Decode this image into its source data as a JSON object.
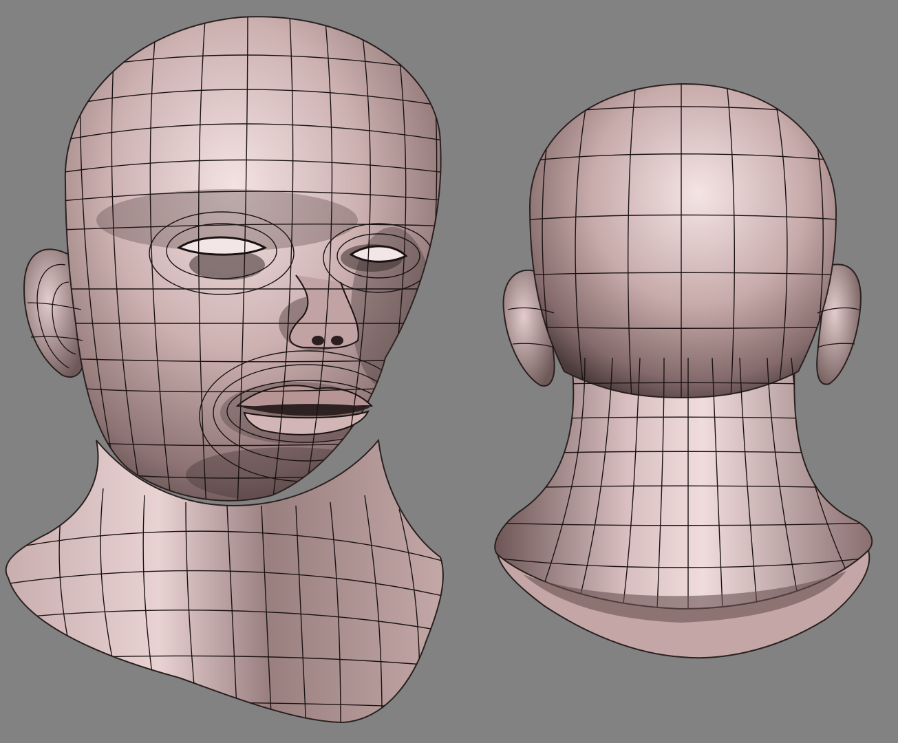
{
  "viewport": {
    "background": "#828282"
  },
  "models": [
    {
      "name": "head-front-three-quarter",
      "view": "front-three-quarter",
      "display": "shaded-wireframe"
    },
    {
      "name": "head-back",
      "view": "back",
      "display": "shaded-wireframe"
    }
  ],
  "colors": {
    "skin_light": "#f1dcdc",
    "skin_mid": "#b89a9a",
    "skin_dark": "#3f3232",
    "wire": "#1a1212"
  }
}
